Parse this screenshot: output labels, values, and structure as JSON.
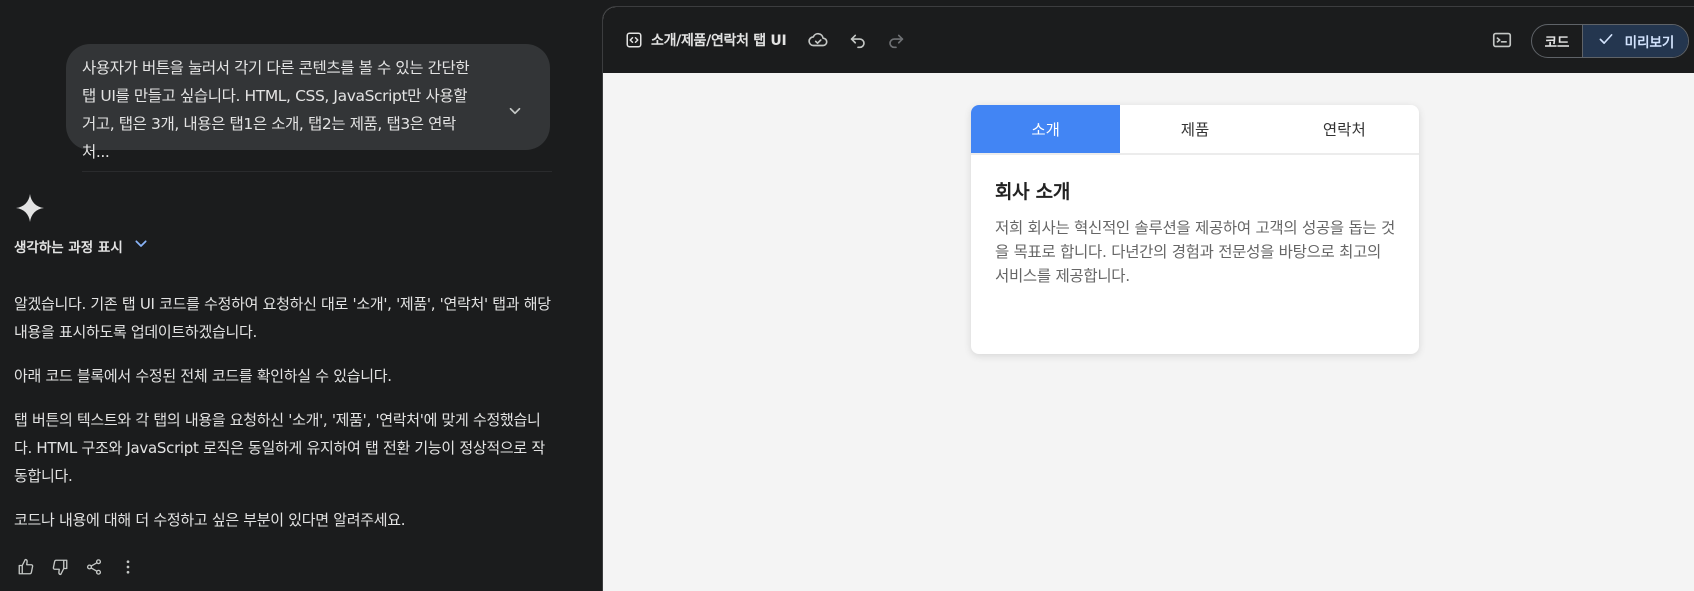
{
  "chat": {
    "user_message": "사용자가 버튼을 눌러서 각기 다른 콘텐츠를 볼 수 있는 간단한 탭 UI를 만들고 싶습니다. HTML, CSS, JavaScript만 사용할 거고, 탭은 3개, 내용은 탭1은 소개, 탭2는 제품, 탭3은 연락처...",
    "thinking_label": "생각하는 과정 표시",
    "response": [
      "알겠습니다. 기존 탭 UI 코드를 수정하여 요청하신 대로 '소개', '제품', '연락처' 탭과 해당 내용을 표시하도록 업데이트하겠습니다.",
      "아래 코드 블록에서 수정된 전체 코드를 확인하실 수 있습니다.",
      "탭 버튼의 텍스트와 각 탭의 내용을 요청하신 '소개', '제품', '연락처'에 맞게 수정했습니다. HTML 구조와 JavaScript 로직은 동일하게 유지하여 탭 전환 기능이 정상적으로 작동합니다.",
      "코드나 내용에 대해 더 수정하고 싶은 부분이 있다면 알려주세요."
    ],
    "actions": [
      "thumbs-up-icon",
      "thumbs-down-icon",
      "share-icon",
      "more-vert-icon"
    ]
  },
  "canvas": {
    "title": "소개/제품/연락처 탭 UI",
    "toggle": {
      "code_label": "코드",
      "preview_label": "미리보기",
      "selected": "preview"
    },
    "accent": "#4285f4"
  },
  "preview": {
    "tabs": [
      "소개",
      "제품",
      "연락처"
    ],
    "active_tab": 0,
    "content_title": "회사 소개",
    "content_text": "저희 회사는 혁신적인 솔루션을 제공하여 고객의 성공을 돕는 것을 목표로 합니다. 다년간의 경험과 전문성을 바탕으로 최고의 서비스를 제공합니다."
  }
}
